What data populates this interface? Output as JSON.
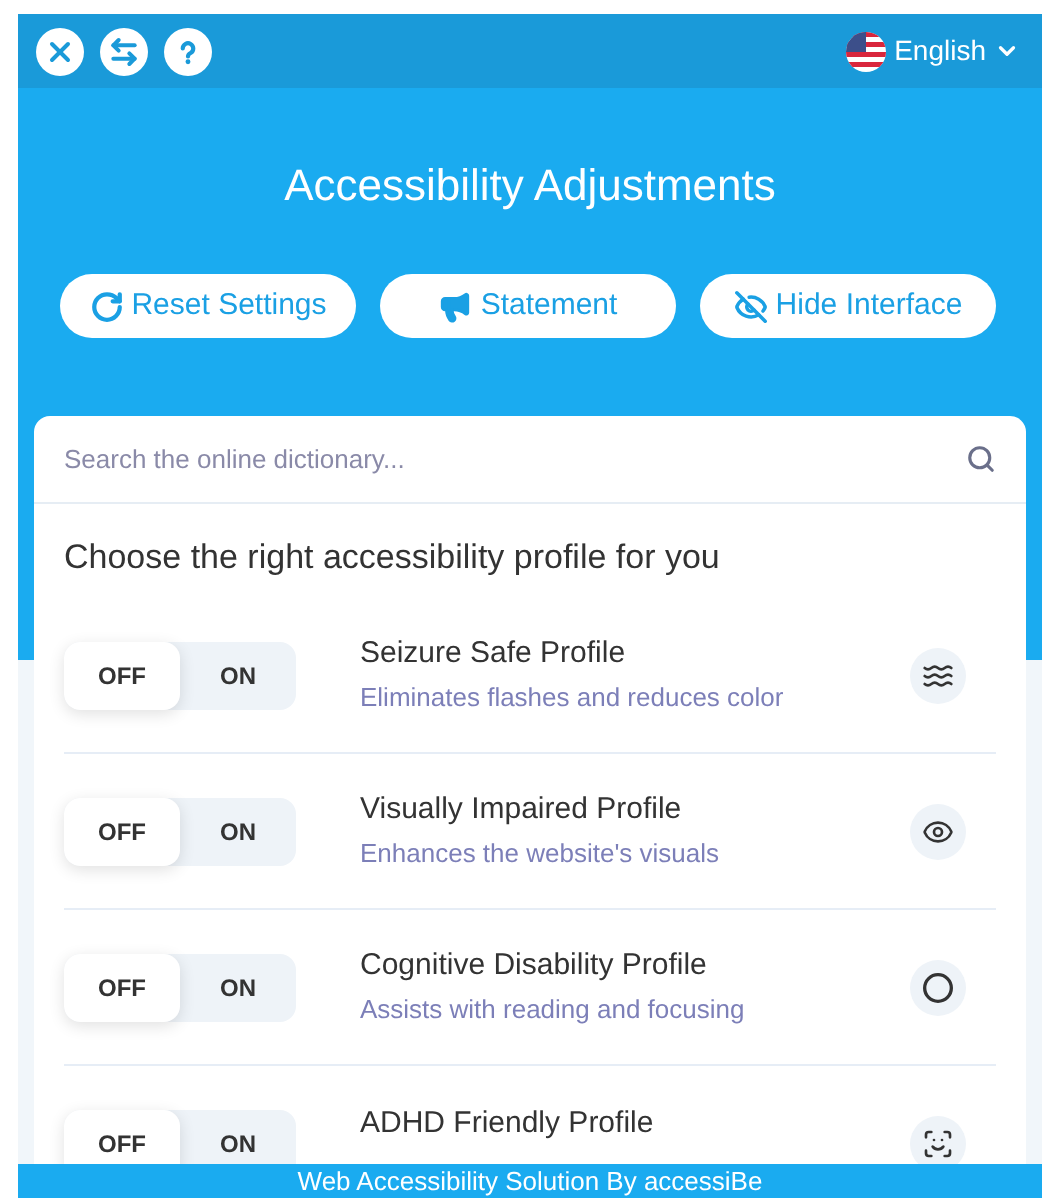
{
  "header": {
    "language": "English"
  },
  "title": "Accessibility Adjustments",
  "actions": [
    {
      "kind": "reset",
      "label": "Reset Settings"
    },
    {
      "kind": "statement",
      "label": "Statement"
    },
    {
      "kind": "hide",
      "label": "Hide Interface"
    }
  ],
  "search": {
    "placeholder": "Search the online dictionary..."
  },
  "profiles_heading": "Choose the right accessibility profile for you",
  "profiles": [
    {
      "kind": "waves",
      "off_label": "OFF",
      "on_label": "ON",
      "on": false,
      "name": "Seizure Safe Profile",
      "description": "Eliminates flashes and reduces color"
    },
    {
      "kind": "eye",
      "off_label": "OFF",
      "on_label": "ON",
      "on": false,
      "name": "Visually Impaired Profile",
      "description": "Enhances the website's visuals"
    },
    {
      "kind": "brain",
      "off_label": "OFF",
      "on_label": "ON",
      "on": false,
      "name": "Cognitive Disability Profile",
      "description": "Assists with reading and focusing"
    },
    {
      "kind": "focus",
      "off_label": "OFF",
      "on_label": "ON",
      "on": false,
      "name": "ADHD Friendly Profile"
    }
  ],
  "footer": "Web Accessibility Solution By accessiBe"
}
